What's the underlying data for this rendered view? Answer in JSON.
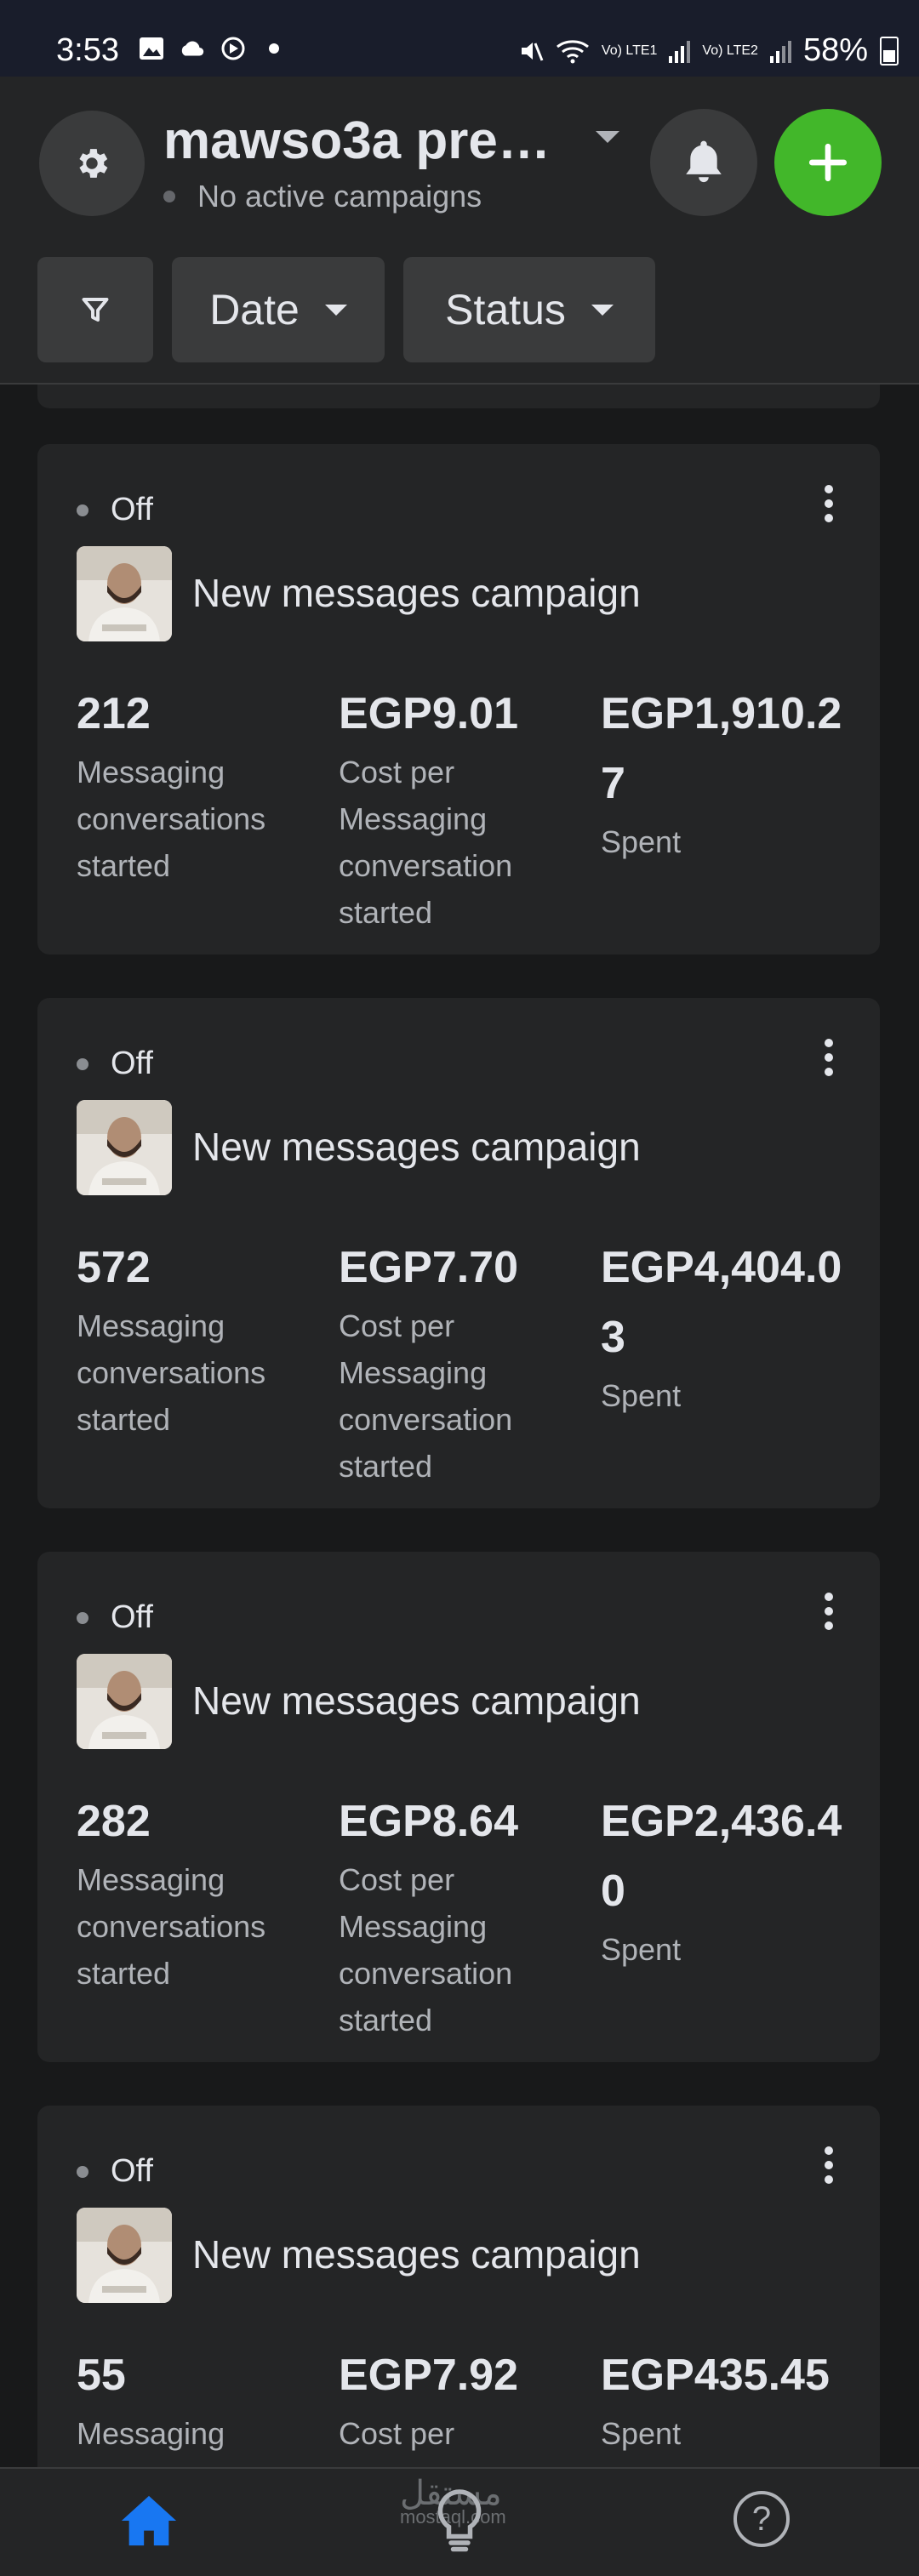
{
  "status_bar": {
    "time": "3:53",
    "volte1": "Vo) LTE1",
    "volte2": "Vo) LTE2",
    "battery": "58%"
  },
  "header": {
    "account_name": "mawso3a pre…",
    "account_status": "No active campaigns",
    "filters": {
      "date_label": "Date",
      "status_label": "Status"
    }
  },
  "campaigns": [
    {
      "status": "Off",
      "name": "New messages campaign",
      "results": "212",
      "results_label": "Messaging conversations started",
      "cost": "EGP9.01",
      "cost_label": "Cost per Messaging conversation started",
      "spent": "EGP1,910.27",
      "spent_label": "Spent"
    },
    {
      "status": "Off",
      "name": "New messages campaign",
      "results": "572",
      "results_label": "Messaging conversations started",
      "cost": "EGP7.70",
      "cost_label": "Cost per Messaging conversation started",
      "spent": "EGP4,404.03",
      "spent_label": "Spent"
    },
    {
      "status": "Off",
      "name": "New messages campaign",
      "results": "282",
      "results_label": "Messaging conversations started",
      "cost": "EGP8.64",
      "cost_label": "Cost per Messaging conversation started",
      "spent": "EGP2,436.40",
      "spent_label": "Spent"
    },
    {
      "status": "Off",
      "name": "New messages campaign",
      "results": "55",
      "results_label": "Messaging conversations started",
      "cost": "EGP7.92",
      "cost_label": "Cost per Messaging conversation started",
      "spent": "EGP435.45",
      "spent_label": "Spent"
    }
  ],
  "bottom_nav": {
    "help": "?"
  },
  "watermark": {
    "text": "مستقل",
    "sub": "mostaql.com"
  },
  "colors": {
    "accent_green": "#42b72a",
    "accent_blue": "#1877f2",
    "background": "#18191a",
    "card": "#242526"
  },
  "icons": [
    "gear-icon",
    "bell-icon",
    "plus-icon",
    "filter-icon",
    "more-icon",
    "home-icon",
    "lightbulb-icon",
    "help-icon"
  ]
}
